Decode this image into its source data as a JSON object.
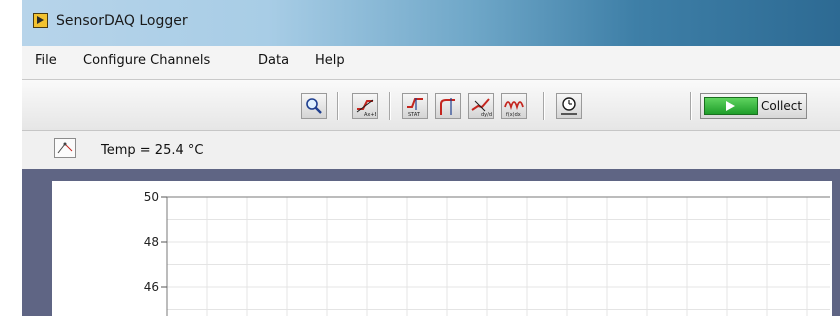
{
  "window": {
    "title": "SensorDAQ Logger",
    "icon": "labview-app-icon"
  },
  "menu": {
    "items": [
      "File",
      "Configure Channels",
      "Data",
      "Help"
    ]
  },
  "toolbar": {
    "buttons": [
      {
        "icon": "magnifier-zoom-icon"
      },
      {
        "icon": "curve-fit-icon",
        "label": "Ax+B"
      },
      {
        "icon": "statistics-icon",
        "label": "STAT"
      },
      {
        "icon": "tangent-icon"
      },
      {
        "icon": "slope-icon",
        "label": "dy/dx"
      },
      {
        "icon": "integral-icon",
        "label": "f(x)dx"
      },
      {
        "icon": "clock-data-collection-icon"
      }
    ],
    "collect_label": "Collect"
  },
  "status": {
    "temp_readout": "Temp = 25.4 °C"
  },
  "graph": {
    "y_ticks": [
      "50",
      "48",
      "46"
    ],
    "y_range": [
      45,
      50
    ],
    "grid": true
  },
  "colors": {
    "graph_background": "#5f6584",
    "collect_green": "#1f9e2a",
    "titlebar_accent": "#3e7fa7"
  }
}
